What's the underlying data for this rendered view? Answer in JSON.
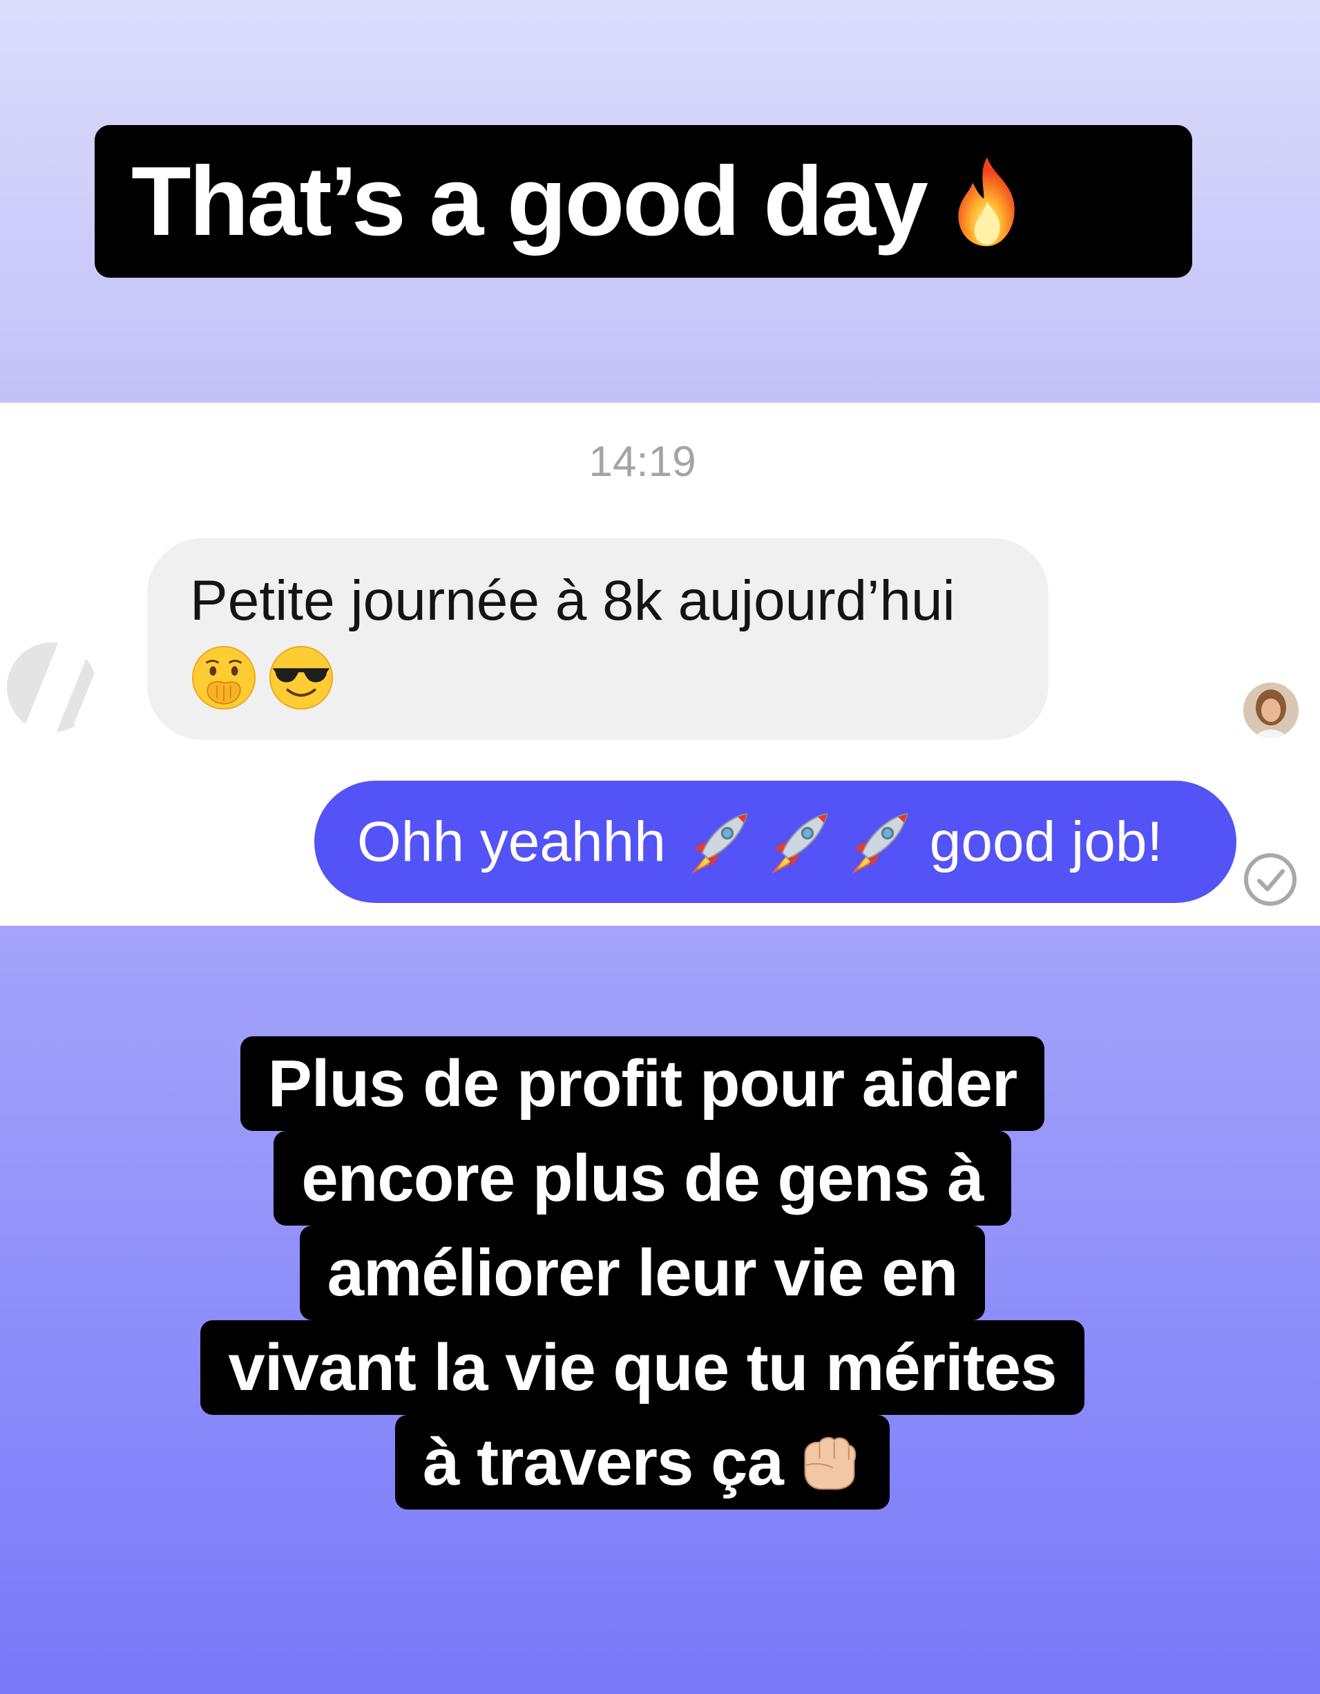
{
  "header": {
    "headline": "That’s a good day",
    "headline_emoji": "fire-emoji"
  },
  "chat": {
    "timestamp": "14:19",
    "incoming": {
      "text": "Petite journée à 8k aujourd’hui",
      "emojis": [
        "face-with-hand-over-mouth-emoji",
        "smiling-face-with-sunglasses-emoji"
      ]
    },
    "outgoing": {
      "text_start": "Ohh yeahhh",
      "emojis": [
        "rocket-emoji",
        "rocket-emoji",
        "rocket-emoji"
      ],
      "text_end": "good job!",
      "bubble_color": "#5353f7"
    },
    "read_receipt_icon": "check-circle-icon"
  },
  "caption": {
    "lines": [
      "Plus de profit pour aider",
      "encore plus de gens à",
      "améliorer leur vie en",
      "vivant la vie que tu mérites",
      "à travers ça"
    ],
    "end_emoji": "fist-emoji"
  },
  "colors": {
    "top_gradient_start": "#dcdcfc",
    "top_gradient_end": "#c2c2f8",
    "bottom_gradient_start": "#a4a4fb",
    "bottom_gradient_end": "#7979f9"
  }
}
